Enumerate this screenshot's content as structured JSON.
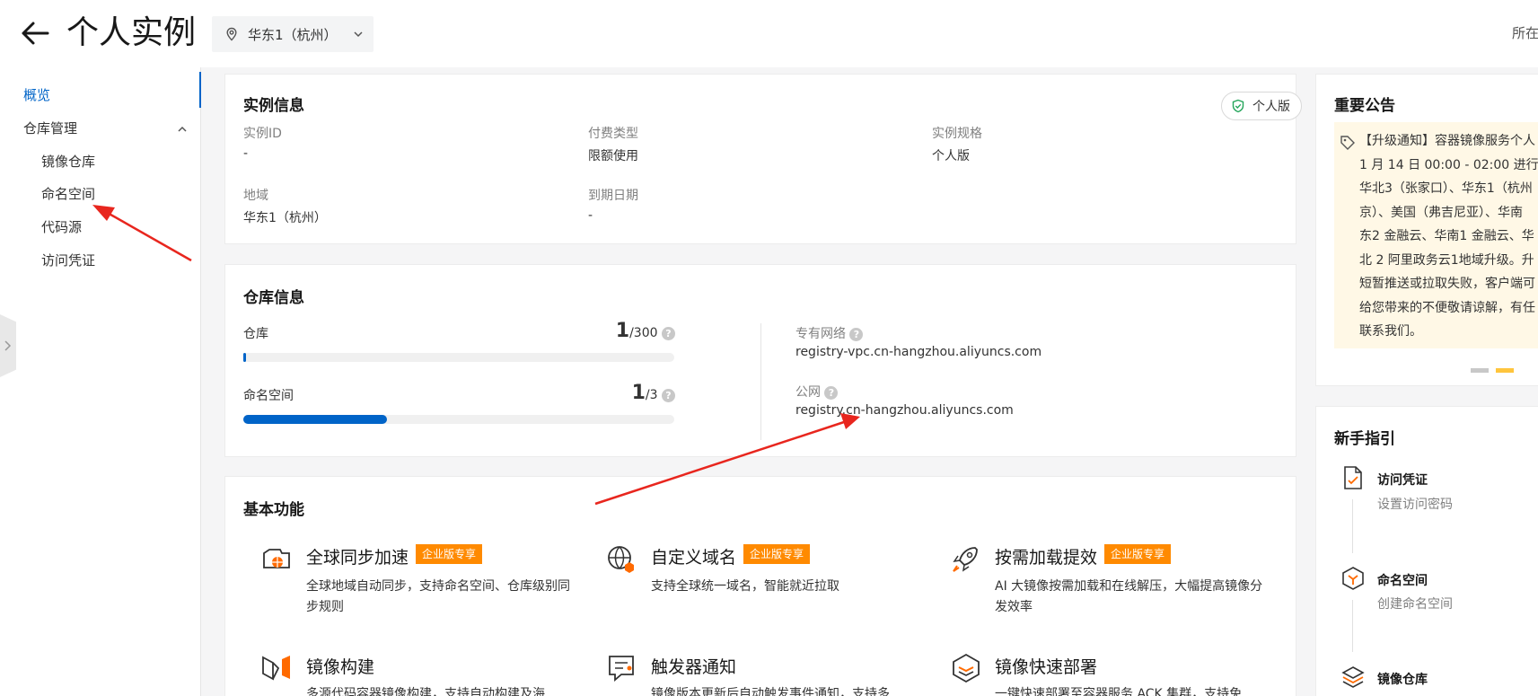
{
  "header": {
    "title": "个人实例",
    "region": "华东1（杭州）",
    "right_text": "所在"
  },
  "sidebar": {
    "items": [
      {
        "label": "概览"
      },
      {
        "label": "仓库管理"
      },
      {
        "label": "镜像仓库"
      },
      {
        "label": "命名空间"
      },
      {
        "label": "代码源"
      },
      {
        "label": "访问凭证"
      }
    ]
  },
  "instance_info": {
    "title": "实例信息",
    "edition_badge": "个人版",
    "fields": [
      {
        "label": "实例ID",
        "value": "-"
      },
      {
        "label": "付费类型",
        "value": "限额使用"
      },
      {
        "label": "实例规格",
        "value": "个人版"
      },
      {
        "label": "地域",
        "value": "华东1（杭州）"
      },
      {
        "label": "到期日期",
        "value": "-"
      }
    ]
  },
  "repo_info": {
    "title": "仓库信息",
    "repo": {
      "label": "仓库",
      "used": "1",
      "total": "/300",
      "fraction": 0.0033
    },
    "namespace": {
      "label": "命名空间",
      "used": "1",
      "total": "/3",
      "fraction": 0.333
    },
    "vpc": {
      "label": "专有网络",
      "value": "registry-vpc.cn-hangzhou.aliyuncs.com"
    },
    "public": {
      "label": "公网",
      "value": "registry.cn-hangzhou.aliyuncs.com"
    },
    "help": "?"
  },
  "features": {
    "title": "基本功能",
    "enterprise_badge": "企业版专享",
    "items": [
      {
        "title": "全球同步加速",
        "desc": "全球地域自动同步，支持命名空间、仓库级别同步规则",
        "enterprise": true
      },
      {
        "title": "自定义域名",
        "desc": "支持全球统一域名，智能就近拉取",
        "enterprise": true
      },
      {
        "title": "按需加载提效",
        "desc": "AI 大镜像按需加载和在线解压，大幅提高镜像分发效率",
        "enterprise": true
      },
      {
        "title": "镜像构建",
        "desc": "多源代码容器镜像构建，支持自动构建及海",
        "enterprise": false
      },
      {
        "title": "触发器通知",
        "desc": "镜像版本更新后自动触发事件通知，支持多",
        "enterprise": false
      },
      {
        "title": "镜像快速部署",
        "desc": "一键快速部署至容器服务 ACK 集群，支持免",
        "enterprise": false
      }
    ]
  },
  "notice": {
    "title": "重要公告",
    "text": "【升级通知】容器镜像服务个人\n1 月 14 日 00:00 - 02:00 进行华\n华北3（张家口）、华东1（杭州\n京）、美国（弗吉尼亚）、华南\n东2 金融云、华南1 金融云、华\n北 2 阿里政务云1地域升级。升\n短暂推送或拉取失败，客户端可\n给您带来的不便敬请谅解，有任\n联系我们。"
  },
  "guide": {
    "title": "新手指引",
    "steps": [
      {
        "title": "访问凭证",
        "desc": "设置访问密码"
      },
      {
        "title": "命名空间",
        "desc": "创建命名空间"
      },
      {
        "title": "镜像仓库",
        "desc": ""
      }
    ]
  },
  "colors": {
    "accent": "#0064c8",
    "enterprise_badge": "#ff8a00",
    "notice_bg": "#fff8e6",
    "annotation_arrow": "#e8261e"
  }
}
